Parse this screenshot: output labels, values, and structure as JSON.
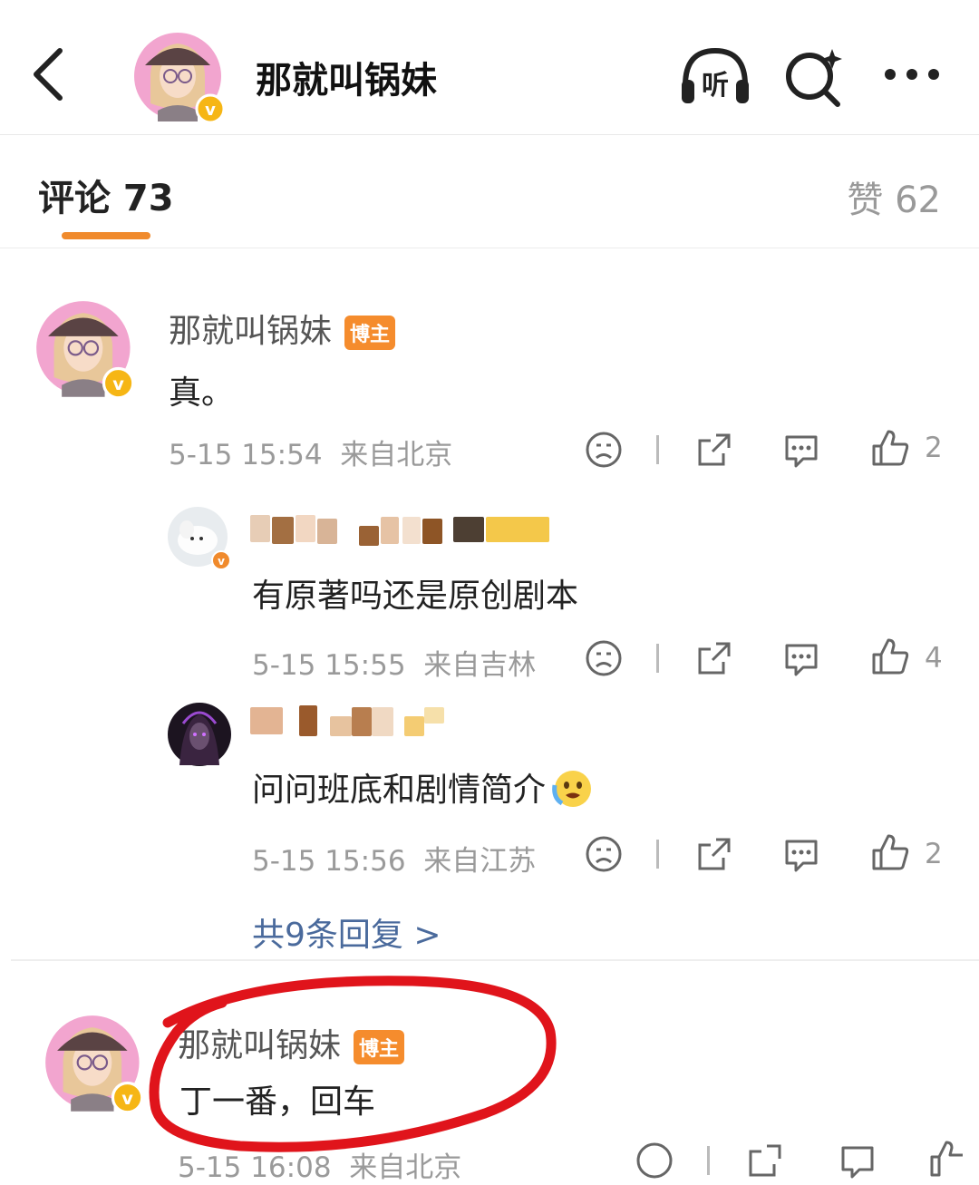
{
  "header": {
    "title": "那就叫锅妹",
    "listen_label": "听"
  },
  "tabs": {
    "comments_label": "评论 73",
    "likes_label": "赞 62"
  },
  "comments": [
    {
      "name": "那就叫锅妹",
      "badge": "博主",
      "text": "真。",
      "time": "5-15 15:54",
      "location": "来自北京",
      "likes": "2",
      "replies": [
        {
          "name": "",
          "text": "有原著吗还是原创剧本",
          "time": "5-15 15:55",
          "location": "来自吉林",
          "likes": "4"
        },
        {
          "name": "",
          "text": "问问班底和剧情简介",
          "time": "5-15 15:56",
          "location": "来自江苏",
          "likes": "2"
        }
      ],
      "more_replies": "共9条回复 >"
    },
    {
      "name": "那就叫锅妹",
      "badge": "博主",
      "text": "丁一番，回车",
      "time": "5-15 16:08",
      "location": "来自北京"
    }
  ],
  "colors": {
    "accent": "#f08a2c",
    "badge": "#f58c2d",
    "link": "#4a6a9c",
    "annotation": "#e0141b",
    "verified": "#f6b615"
  }
}
